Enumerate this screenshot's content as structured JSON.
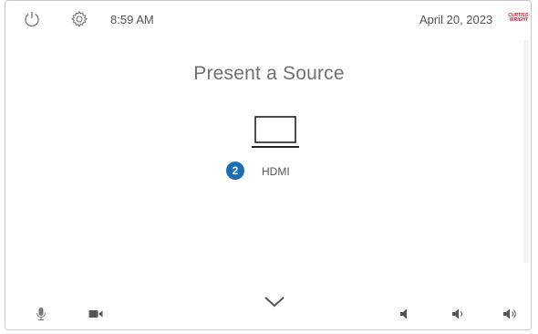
{
  "header": {
    "time": "8:59 AM",
    "date": "April 20, 2023",
    "brand_line1": "CURTISS-",
    "brand_line2": "WRIGHT"
  },
  "main": {
    "title": "Present a Source",
    "sources": [
      {
        "number": "2",
        "label": "HDMI",
        "icon": "laptop-icon"
      }
    ]
  },
  "footer": {
    "icons": [
      "microphone-icon",
      "camera-icon",
      "chevron-down-icon",
      "volume-mute-icon",
      "volume-down-icon",
      "volume-up-icon"
    ]
  },
  "colors": {
    "accent": "#1a6fb3",
    "brand": "#e0112b",
    "text": "#555555"
  }
}
